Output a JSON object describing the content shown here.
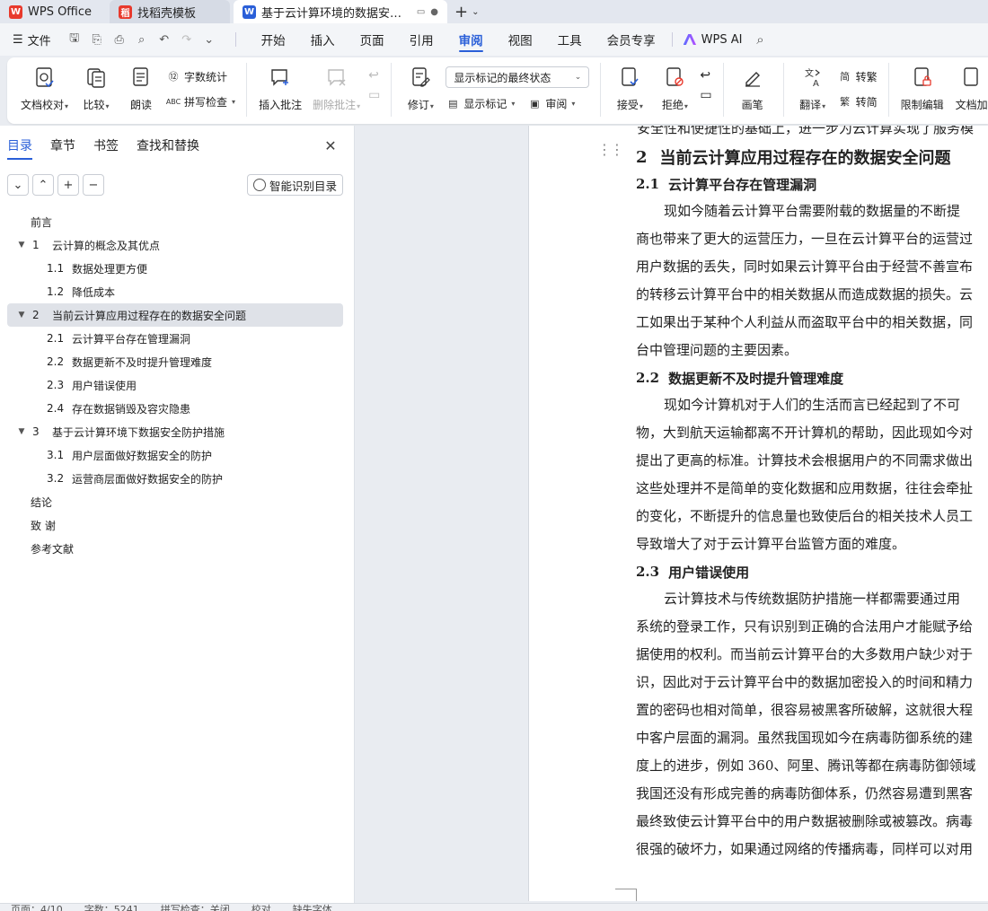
{
  "tabs": [
    {
      "label": "WPS Office",
      "icon": "wps-logo-icon",
      "color": "#e8392c"
    },
    {
      "label": "找稻壳模板",
      "icon": "docer-icon",
      "color": "#e8392c"
    },
    {
      "label": "基于云计算环境的数据安全研究",
      "icon": "writer-doc-icon",
      "color": "#2a5fd8"
    }
  ],
  "menubar": {
    "file_label": "文件",
    "items": [
      "开始",
      "插入",
      "页面",
      "引用",
      "审阅",
      "视图",
      "工具",
      "会员专享"
    ],
    "active": "审阅",
    "ai_label": "WPS AI"
  },
  "ribbon": {
    "doc_check": "文档校对",
    "compare": "比较",
    "read_aloud": "朗读",
    "word_count": "字数统计",
    "spell_check": "拼写检查",
    "insert_comment": "插入批注",
    "delete_comment": "删除批注",
    "revise": "修订",
    "display_mode": "显示标记的最终状态",
    "show_markup": "显示标记",
    "review": "审阅",
    "accept": "接受",
    "reject": "拒绝",
    "ink": "画笔",
    "translate": "翻译",
    "to_traditional": "转繁",
    "to_simplified": "转简",
    "restrict_edit": "限制编辑",
    "doc_protect": "文档加"
  },
  "sidebar": {
    "tabs": [
      "目录",
      "章节",
      "书签",
      "查找和替换"
    ],
    "active_tab": "目录",
    "smart_toc": "智能识别目录",
    "toc": [
      {
        "num": "",
        "text": "前言",
        "level": 0,
        "expand": false
      },
      {
        "num": "1",
        "text": "云计算的概念及其优点",
        "level": 1,
        "expand": true
      },
      {
        "num": "1.1",
        "text": "数据处理更方便",
        "level": 2,
        "expand": false
      },
      {
        "num": "1.2",
        "text": "降低成本",
        "level": 2,
        "expand": false
      },
      {
        "num": "2",
        "text": "当前云计算应用过程存在的数据安全问题",
        "level": 1,
        "expand": true,
        "selected": true
      },
      {
        "num": "2.1",
        "text": "云计算平台存在管理漏洞",
        "level": 2,
        "expand": false
      },
      {
        "num": "2.2",
        "text": "数据更新不及时提升管理难度",
        "level": 2,
        "expand": false
      },
      {
        "num": "2.3",
        "text": "用户错误使用",
        "level": 2,
        "expand": false
      },
      {
        "num": "2.4",
        "text": "存在数据销毁及容灾隐患",
        "level": 2,
        "expand": false
      },
      {
        "num": "3",
        "text": "基于云计算环境下数据安全防护措施",
        "level": 1,
        "expand": true
      },
      {
        "num": "3.1",
        "text": "用户层面做好数据安全的防护",
        "level": 2,
        "expand": false
      },
      {
        "num": "3.2",
        "text": "运营商层面做好数据安全的防护",
        "level": 2,
        "expand": false
      },
      {
        "num": "",
        "text": "结论",
        "level": 0,
        "expand": false
      },
      {
        "num": "",
        "text": "致 谢",
        "level": 0,
        "expand": false
      },
      {
        "num": "",
        "text": "参考文献",
        "level": 0,
        "expand": false
      }
    ]
  },
  "document": {
    "prev_line": "安全性和使捷性的基础上，进一步为云计算实现了服务模",
    "h1_num": "2",
    "h1_text": "当前云计算应用过程存在的数据安全问题",
    "sections": [
      {
        "num": "2.1",
        "title": "云计算平台存在管理漏洞",
        "lines": [
          "现如今随着云计算平台需要附载的数据量的不断提",
          "商也带来了更大的运营压力，一旦在云计算平台的运营过",
          "用户数据的丢失，同时如果云计算平台由于经营不善宣布",
          "的转移云计算平台中的相关数据从而造成数据的损失。云",
          "工如果出于某种个人利益从而盗取平台中的相关数据，同",
          "台中管理问题的主要因素。"
        ]
      },
      {
        "num": "2.2",
        "title": "数据更新不及时提升管理难度",
        "lines": [
          "现如今计算机对于人们的生活而言已经起到了不可",
          "物，大到航天运输都离不开计算机的帮助，因此现如今对",
          "提出了更高的标准。计算技术会根据用户的不同需求做出",
          "这些处理并不是简单的变化数据和应用数据，往往会牵扯",
          "的变化，不断提升的信息量也致使后台的相关技术人员工",
          "导致增大了对于云计算平台监管方面的难度。"
        ]
      },
      {
        "num": "2.3",
        "title": "用户错误使用",
        "lines": [
          "云计算技术与传统数据防护措施一样都需要通过用",
          "系统的登录工作，只有识别到正确的合法用户才能赋予给",
          "据使用的权利。而当前云计算平台的大多数用户缺少对于",
          "识，因此对于云计算平台中的数据加密投入的时间和精力",
          "置的密码也相对简单，很容易被黑客所破解，这就很大程",
          "中客户层面的漏洞。虽然我国现如今在病毒防御系统的建",
          "度上的进步，例如 360、阿里、腾讯等都在病毒防御领域",
          "我国还没有形成完善的病毒防御体系，仍然容易遭到黑客",
          "最终致使云计算平台中的用户数据被删除或被篡改。病毒",
          "很强的破坏力，如果通过网络的传播病毒，同样可以对用"
        ]
      }
    ]
  },
  "statusbar": {
    "page": "页面：4/10",
    "words": "字数：5241",
    "spell": "拼写检查：关闭",
    "proof": "校对",
    "font_missing": "缺失字体"
  },
  "colors": {
    "accent": "#2a5fd8",
    "wps_red": "#e8392c"
  }
}
